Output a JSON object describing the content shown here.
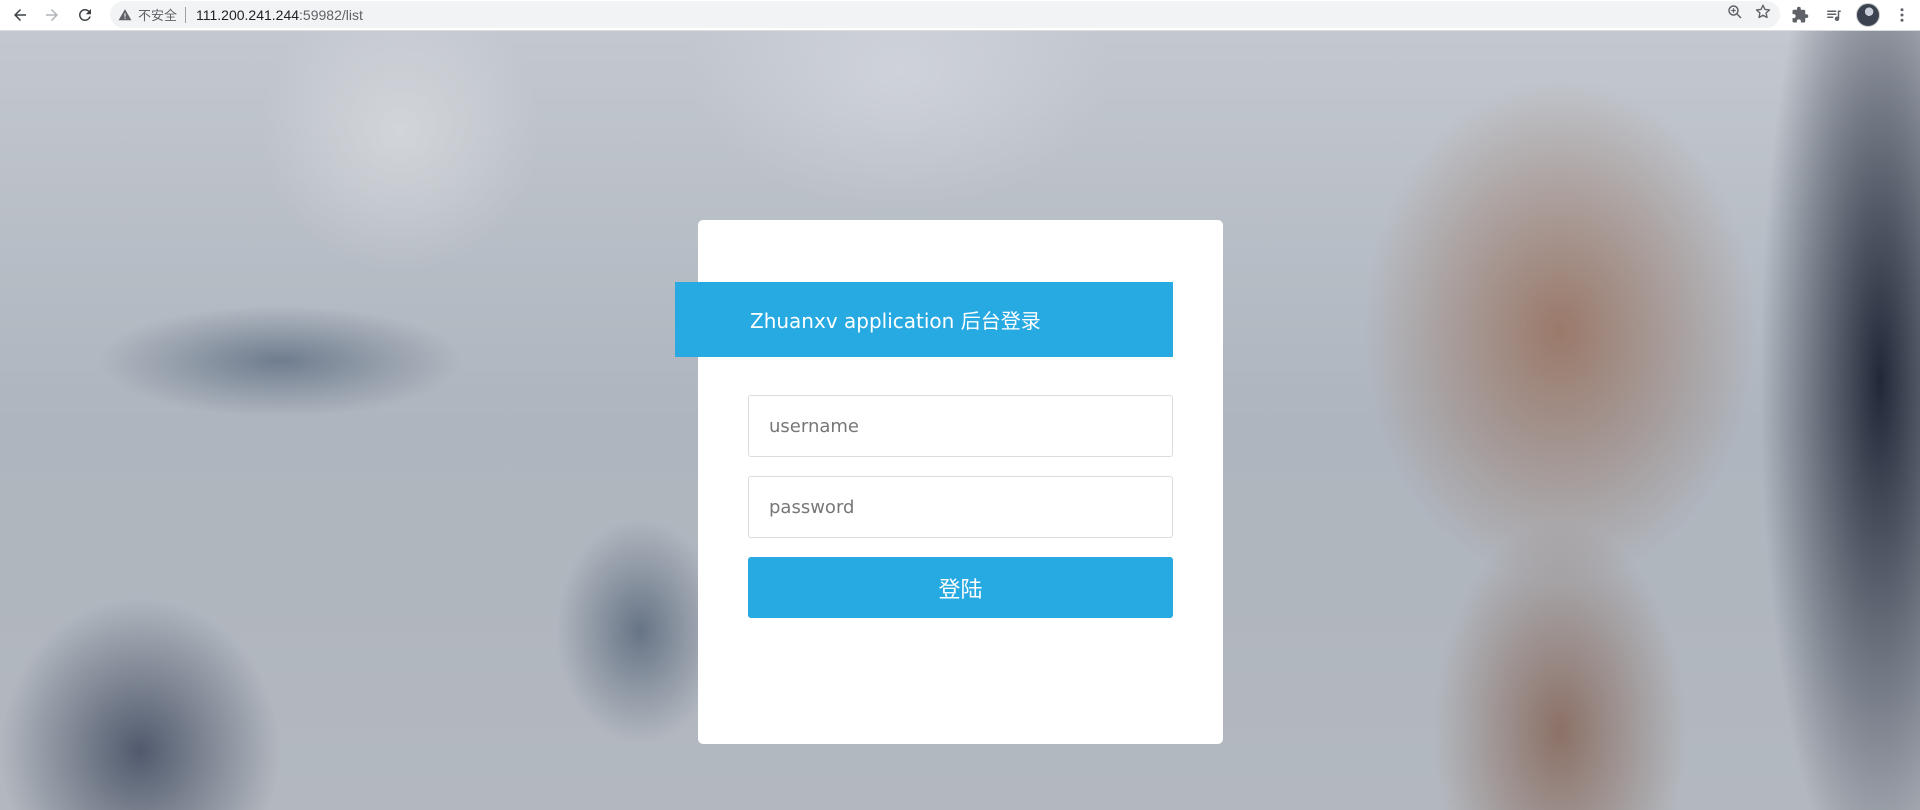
{
  "browser": {
    "security_label": "不安全",
    "url_host": "111.200.241.244",
    "url_rest": ":59982/list"
  },
  "icons": [
    "back-icon",
    "forward-icon",
    "reload-icon",
    "warning-icon",
    "zoom-icon",
    "bookmark-star-icon",
    "extensions-icon",
    "reading-list-icon",
    "profile-avatar",
    "menu-icon"
  ],
  "login": {
    "title": "Zhuanxv application 后台登录",
    "username_placeholder": "username",
    "password_placeholder": "password",
    "button_label": "登陆"
  },
  "colors": {
    "accent": "#27a9e1",
    "card": "#ffffff"
  }
}
